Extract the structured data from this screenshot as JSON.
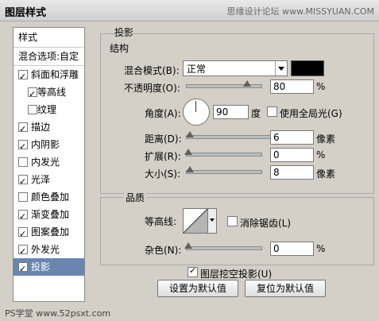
{
  "window": {
    "title": "图层样式",
    "watermark": "思缘设计论坛 www.MISSYUAN.COM",
    "watermark_bottom": "PS学堂 www.52psxt.com"
  },
  "sidebar": {
    "header": "样式",
    "blend_options": "混合选项:自定",
    "items": [
      {
        "label": "斜面和浮雕",
        "checked": true
      },
      {
        "label": "等高线",
        "checked": true
      },
      {
        "label": "纹理",
        "checked": false
      },
      {
        "label": "描边",
        "checked": true
      },
      {
        "label": "内阴影",
        "checked": true
      },
      {
        "label": "内发光",
        "checked": false
      },
      {
        "label": "光泽",
        "checked": true
      },
      {
        "label": "颜色叠加",
        "checked": false
      },
      {
        "label": "渐变叠加",
        "checked": true
      },
      {
        "label": "图案叠加",
        "checked": true
      },
      {
        "label": "外发光",
        "checked": true
      },
      {
        "label": "投影",
        "checked": true
      }
    ]
  },
  "panel": {
    "title": "投影",
    "structure": {
      "title": "结构",
      "blend_mode_label": "混合模式(B):",
      "blend_mode_value": "正常",
      "swatch_color": "#000000",
      "opacity_label": "不透明度(O):",
      "opacity_value": "80",
      "opacity_unit": "%",
      "opacity_level": 0.8,
      "angle_label": "角度(A):",
      "angle_value": "90",
      "angle_unit": "度",
      "global_light_label": "使用全局光(G)",
      "global_light_checked": false,
      "distance_label": "距离(D):",
      "distance_value": "6",
      "distance_unit": "像素",
      "spread_label": "扩展(R):",
      "spread_value": "0",
      "spread_unit": "%",
      "size_label": "大小(S):",
      "size_value": "8",
      "size_unit": "像素"
    },
    "quality": {
      "title": "品质",
      "contour_label": "等高线:",
      "anti_alias_label": "消除锯齿(L)",
      "anti_alias_checked": false,
      "noise_label": "杂色(N):",
      "noise_value": "0",
      "noise_unit": "%"
    },
    "knockout_label": "图层挖空投影(U)",
    "knockout_checked": true,
    "set_default_label": "设置为默认值",
    "reset_default_label": "复位为默认值"
  }
}
